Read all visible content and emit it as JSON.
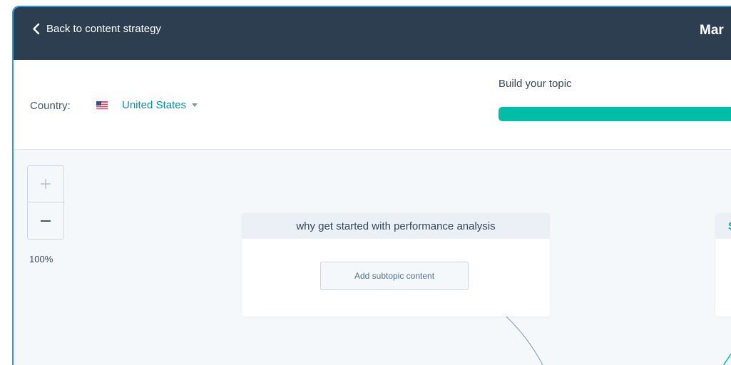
{
  "header": {
    "back_label": "Back to content strategy",
    "title_fragment": "Mar"
  },
  "controls": {
    "country_label": "Country:",
    "country_value": "United States",
    "build_label": "Build your topic",
    "progress_percent": 100
  },
  "canvas": {
    "zoom_in_symbol": "+",
    "zoom_out_symbol": "—",
    "zoom_level": "100%",
    "subtopic_card": {
      "title": "why get started with performance analysis",
      "button_label": "Add subtopic content"
    },
    "partial_card": {
      "title_fragment": "S"
    }
  },
  "colors": {
    "topbar": "#2d3e50",
    "accent_teal": "#00bda5",
    "link": "#0091ae",
    "frame_border": "#2f9ad6"
  },
  "icons": [
    "chevron-left-icon",
    "us-flag-icon",
    "caret-down-icon",
    "plus-icon",
    "minus-icon"
  ]
}
